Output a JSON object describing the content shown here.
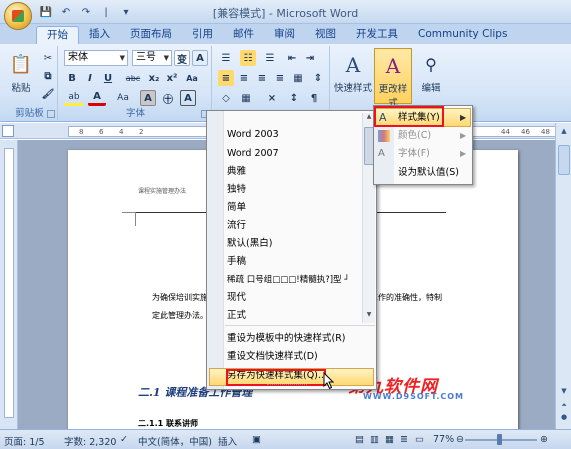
{
  "window": {
    "title": "[兼容模式] - Microsoft Word"
  },
  "qat": {
    "save": "💾",
    "undo": "↶",
    "redo": "↷",
    "sep": "|",
    "customize": "▾"
  },
  "tabs": [
    "开始",
    "插入",
    "页面布局",
    "引用",
    "邮件",
    "审阅",
    "视图",
    "开发工具",
    "Community Clips"
  ],
  "clipboard": {
    "paste_label": "粘贴",
    "group_label": "剪贴板"
  },
  "font": {
    "name": "宋体",
    "size": "三号",
    "wen": "变",
    "A_box": "A",
    "bold": "B",
    "italic": "I",
    "underline": "U",
    "strike": "abc",
    "subscript": "x₂",
    "superscript": "x²",
    "clear": "Aa",
    "highlight": "ab",
    "fontcolor": "A",
    "aa": "Aa",
    "charborder": "A",
    "circle": "㊉",
    "phonetic": "A",
    "group_label": "字体"
  },
  "styles": {
    "quick_label": "快速样式",
    "change_label": "更改样式",
    "edit_label": "编辑"
  },
  "ruler": {
    "left_ticks": [
      "8",
      "6",
      "4",
      "2"
    ],
    "right_ticks": [
      "44",
      "46",
      "48"
    ]
  },
  "document": {
    "header_text": "课程实施管理办法",
    "para1_left": "为确保培训实施",
    "para1_right": "工作的准确性，特制",
    "para2": "定此管理办法。",
    "heading": "二.1 课程准备工作管理",
    "sub": "二.1.1   联系讲师"
  },
  "watermark": {
    "main": "第九软件网",
    "sub": "WWW.D9SOFT.COM"
  },
  "menu": {
    "items": [
      "Word 2003",
      "Word 2007",
      "典雅",
      "独特",
      "简单",
      "流行",
      "默认(黑白)",
      "手稿",
      "稀疏   口号组□□□!精髓执?]型 ┘",
      "现代",
      "正式"
    ],
    "reset_template": "重设为模板中的快速样式(R)",
    "reset_doc": "重设文档快速样式(D)",
    "save_as": "另存为快速样式集(Q)..."
  },
  "submenu": {
    "styleset": "样式集(Y)",
    "colors": "颜色(C)",
    "fonts": "字体(F)",
    "set_default": "设为默认值(S)"
  },
  "status": {
    "page": "页面: 1/5",
    "words": "字数: 2,320",
    "language": "中文(简体，中国)",
    "insert": "插入",
    "zoom": "77%"
  }
}
